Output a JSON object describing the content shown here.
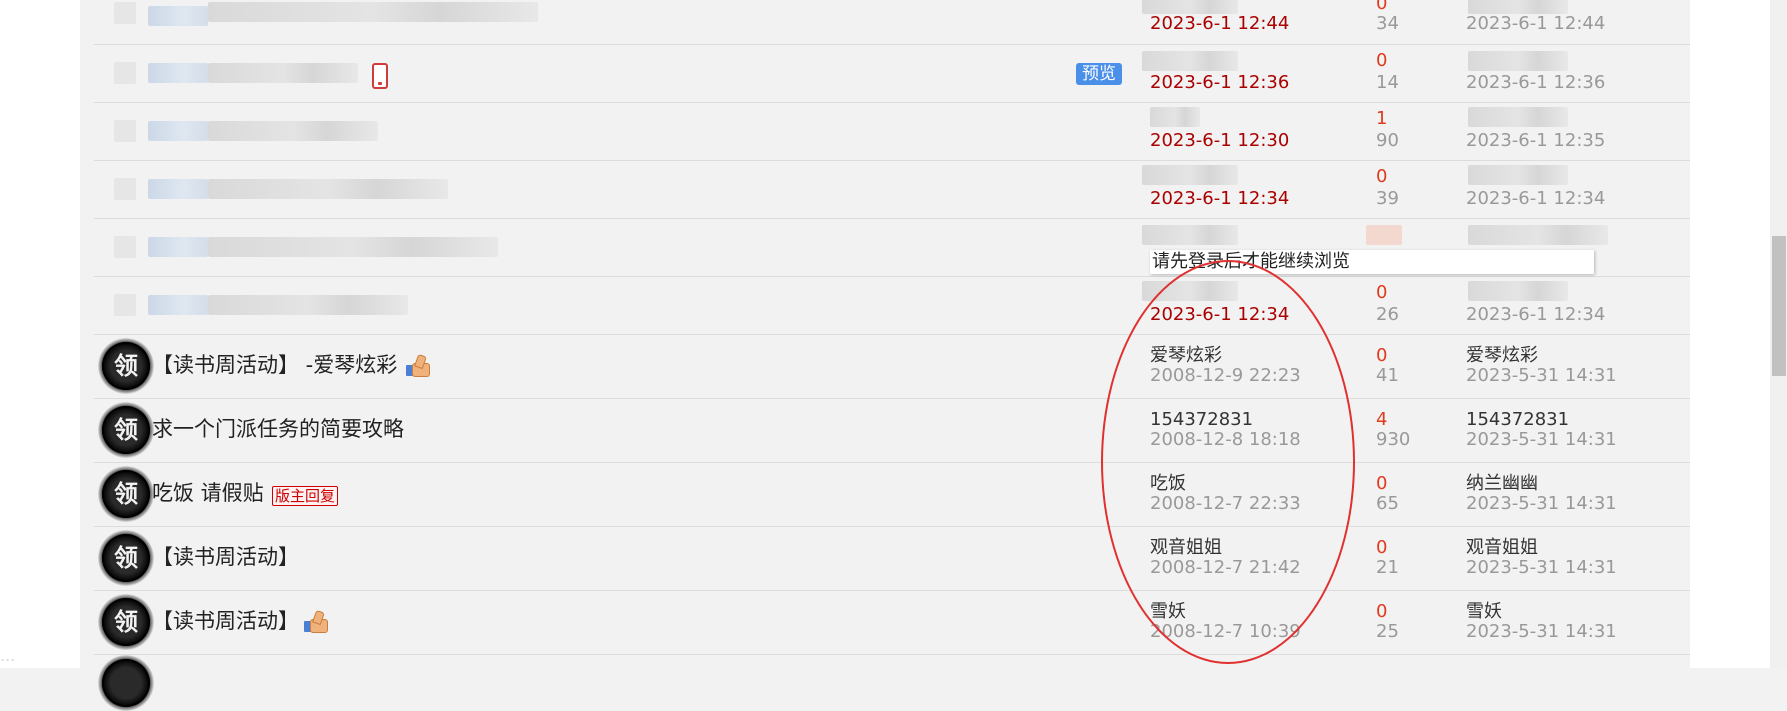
{
  "ui": {
    "preview_badge": "预览",
    "login_prompt": "请先登录后才能继续浏览",
    "watermark": "..."
  },
  "threads_blurred": [
    {
      "author_time": "2023-6-1 12:44",
      "replies": "0",
      "views": "34",
      "last_post_time": "2023-6-1 12:44"
    },
    {
      "author_time": "2023-6-1 12:36",
      "replies": "0",
      "views": "14",
      "last_post_time": "2023-6-1 12:36"
    },
    {
      "author_time": "2023-6-1 12:30",
      "replies": "1",
      "views": "90",
      "last_post_time": "2023-6-1 12:35"
    },
    {
      "author_time": "2023-6-1 12:34",
      "replies": "0",
      "views": "39",
      "last_post_time": "2023-6-1 12:34"
    },
    {
      "author_time": "",
      "replies": "",
      "views": "",
      "last_post_time": ""
    },
    {
      "author_time": "2023-6-1 12:34",
      "replies": "0",
      "views": "26",
      "last_post_time": "2023-6-1 12:34"
    }
  ],
  "threads": [
    {
      "title": "【读书周活动】 -爱琴炫彩",
      "author": "爱琴炫彩",
      "author_time": "2008-12-9 22:23",
      "replies": "0",
      "views": "41",
      "last_poster": "爱琴炫彩",
      "last_post_time": "2023-5-31 14:31",
      "has_thumb": true,
      "badge": ""
    },
    {
      "title": "求一个门派任务的简要攻略",
      "author": "154372831",
      "author_time": "2008-12-8 18:18",
      "replies": "4",
      "views": "930",
      "last_poster": "154372831",
      "last_post_time": "2023-5-31 14:31",
      "has_thumb": false,
      "badge": ""
    },
    {
      "title": "吃饭 请假贴",
      "author": "吃饭",
      "author_time": "2008-12-7 22:33",
      "replies": "0",
      "views": "65",
      "last_poster": "纳兰幽幽",
      "last_post_time": "2023-5-31 14:31",
      "has_thumb": false,
      "badge": "版主回复"
    },
    {
      "title": "【读书周活动】",
      "author": "观音姐姐",
      "author_time": "2008-12-7 21:42",
      "replies": "0",
      "views": "21",
      "last_poster": "观音姐姐",
      "last_post_time": "2023-5-31 14:31",
      "has_thumb": false,
      "badge": ""
    },
    {
      "title": "【读书周活动】",
      "author": "雪妖",
      "author_time": "2008-12-7 10:39",
      "replies": "0",
      "views": "25",
      "last_poster": "雪妖",
      "last_post_time": "2023-5-31 14:31",
      "has_thumb": true,
      "badge": ""
    }
  ],
  "avatar_glyph": "领",
  "colors": {
    "accent_red": "#e03030",
    "replies_orange": "#e03b1e",
    "date_red": "#aa0000"
  }
}
